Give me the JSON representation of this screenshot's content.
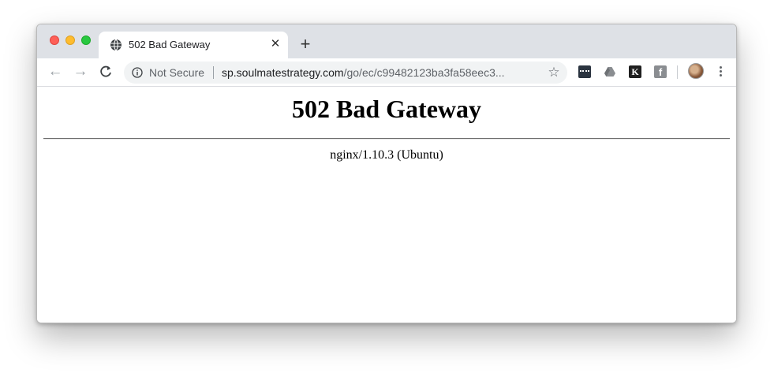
{
  "tab": {
    "title": "502 Bad Gateway",
    "close_icon": "close-icon",
    "favicon": "globe-icon"
  },
  "new_tab_icon": "plus-icon",
  "toolbar": {
    "back_icon": "arrow-left-icon",
    "forward_icon": "arrow-right-icon",
    "reload_icon": "reload-icon",
    "security_label": "Not Secure",
    "url_host": "sp.soulmatestrategy.com",
    "url_path": "/go/ec/c99482123ba3fa58eec3...",
    "bookmark_icon": "star-icon",
    "extensions": [
      "ext-dark-icon",
      "google-drive-icon",
      "k-icon",
      "facebook-icon"
    ],
    "ext3_letter": "K",
    "ext4_letter": "f",
    "menu_icon": "kebab-menu-icon"
  },
  "page": {
    "heading": "502 Bad Gateway",
    "server": "nginx/1.10.3 (Ubuntu)"
  },
  "colors": {
    "tabstrip": "#dee1e6",
    "close_red": "#fe5f57",
    "minimize_yellow": "#febc2e",
    "zoom_green": "#28c840"
  }
}
